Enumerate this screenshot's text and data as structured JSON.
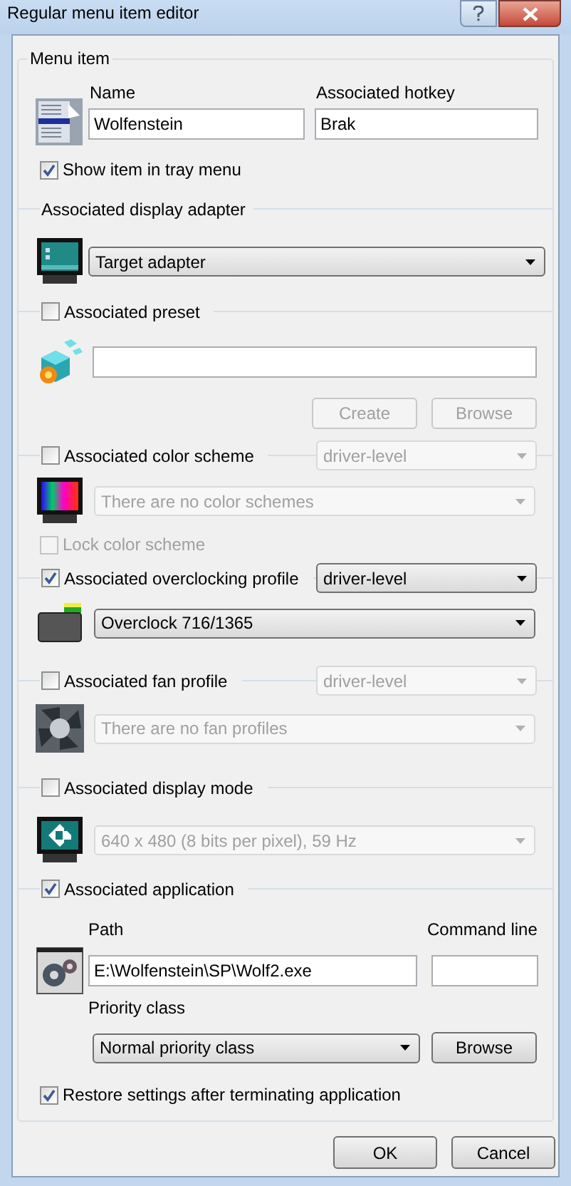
{
  "window": {
    "title": "Regular menu item editor"
  },
  "menu_item": {
    "legend": "Menu item",
    "name_label": "Name",
    "name_value": "Wolfenstein",
    "hotkey_label": "Associated hotkey",
    "hotkey_value": "Brak",
    "show_in_tray": {
      "label": "Show item in tray menu",
      "checked": true
    }
  },
  "sections": [
    {
      "kind": "adapter",
      "header": "Associated display adapter",
      "combo": {
        "value": "Target adapter",
        "disabled": false
      }
    },
    {
      "kind": "preset",
      "header": "Associated preset",
      "checked": false,
      "buttons": [
        {
          "label": "Create",
          "disabled": true
        },
        {
          "label": "Browse",
          "disabled": true
        }
      ]
    },
    {
      "kind": "color",
      "header": "Associated color scheme",
      "checked": false,
      "side_combo": {
        "value": "driver-level",
        "disabled": true
      },
      "combo": {
        "value": "There are no color schemes",
        "disabled": true
      },
      "lock": {
        "label": "Lock color scheme",
        "checked": false,
        "disabled": true
      }
    },
    {
      "kind": "overclock",
      "header": "Associated overclocking profile",
      "checked": true,
      "side_combo": {
        "value": "driver-level",
        "disabled": false
      },
      "combo": {
        "value": "Overclock 716/1365",
        "disabled": false
      }
    },
    {
      "kind": "fan",
      "header": "Associated fan profile",
      "checked": false,
      "side_combo": {
        "value": "driver-level",
        "disabled": true
      },
      "combo": {
        "value": "There are no fan profiles",
        "disabled": true
      }
    },
    {
      "kind": "mode",
      "header": "Associated display mode",
      "checked": false,
      "combo": {
        "value": "640 x 480 (8 bits per pixel), 59 Hz",
        "disabled": true
      }
    },
    {
      "kind": "application",
      "header": "Associated application",
      "checked": true,
      "path_label": "Path",
      "path_value": "E:\\Wolfenstein\\SP\\Wolf2.exe",
      "cmd_label": "Command line",
      "priority_label": "Priority class",
      "priority": {
        "value": "Normal priority class",
        "disabled": false
      },
      "browse": {
        "label": "Browse",
        "disabled": false
      },
      "restore": {
        "label": "Restore settings after terminating application",
        "checked": true,
        "disabled": false
      }
    }
  ],
  "buttons": [
    {
      "label": "OK"
    },
    {
      "label": "Cancel"
    }
  ]
}
